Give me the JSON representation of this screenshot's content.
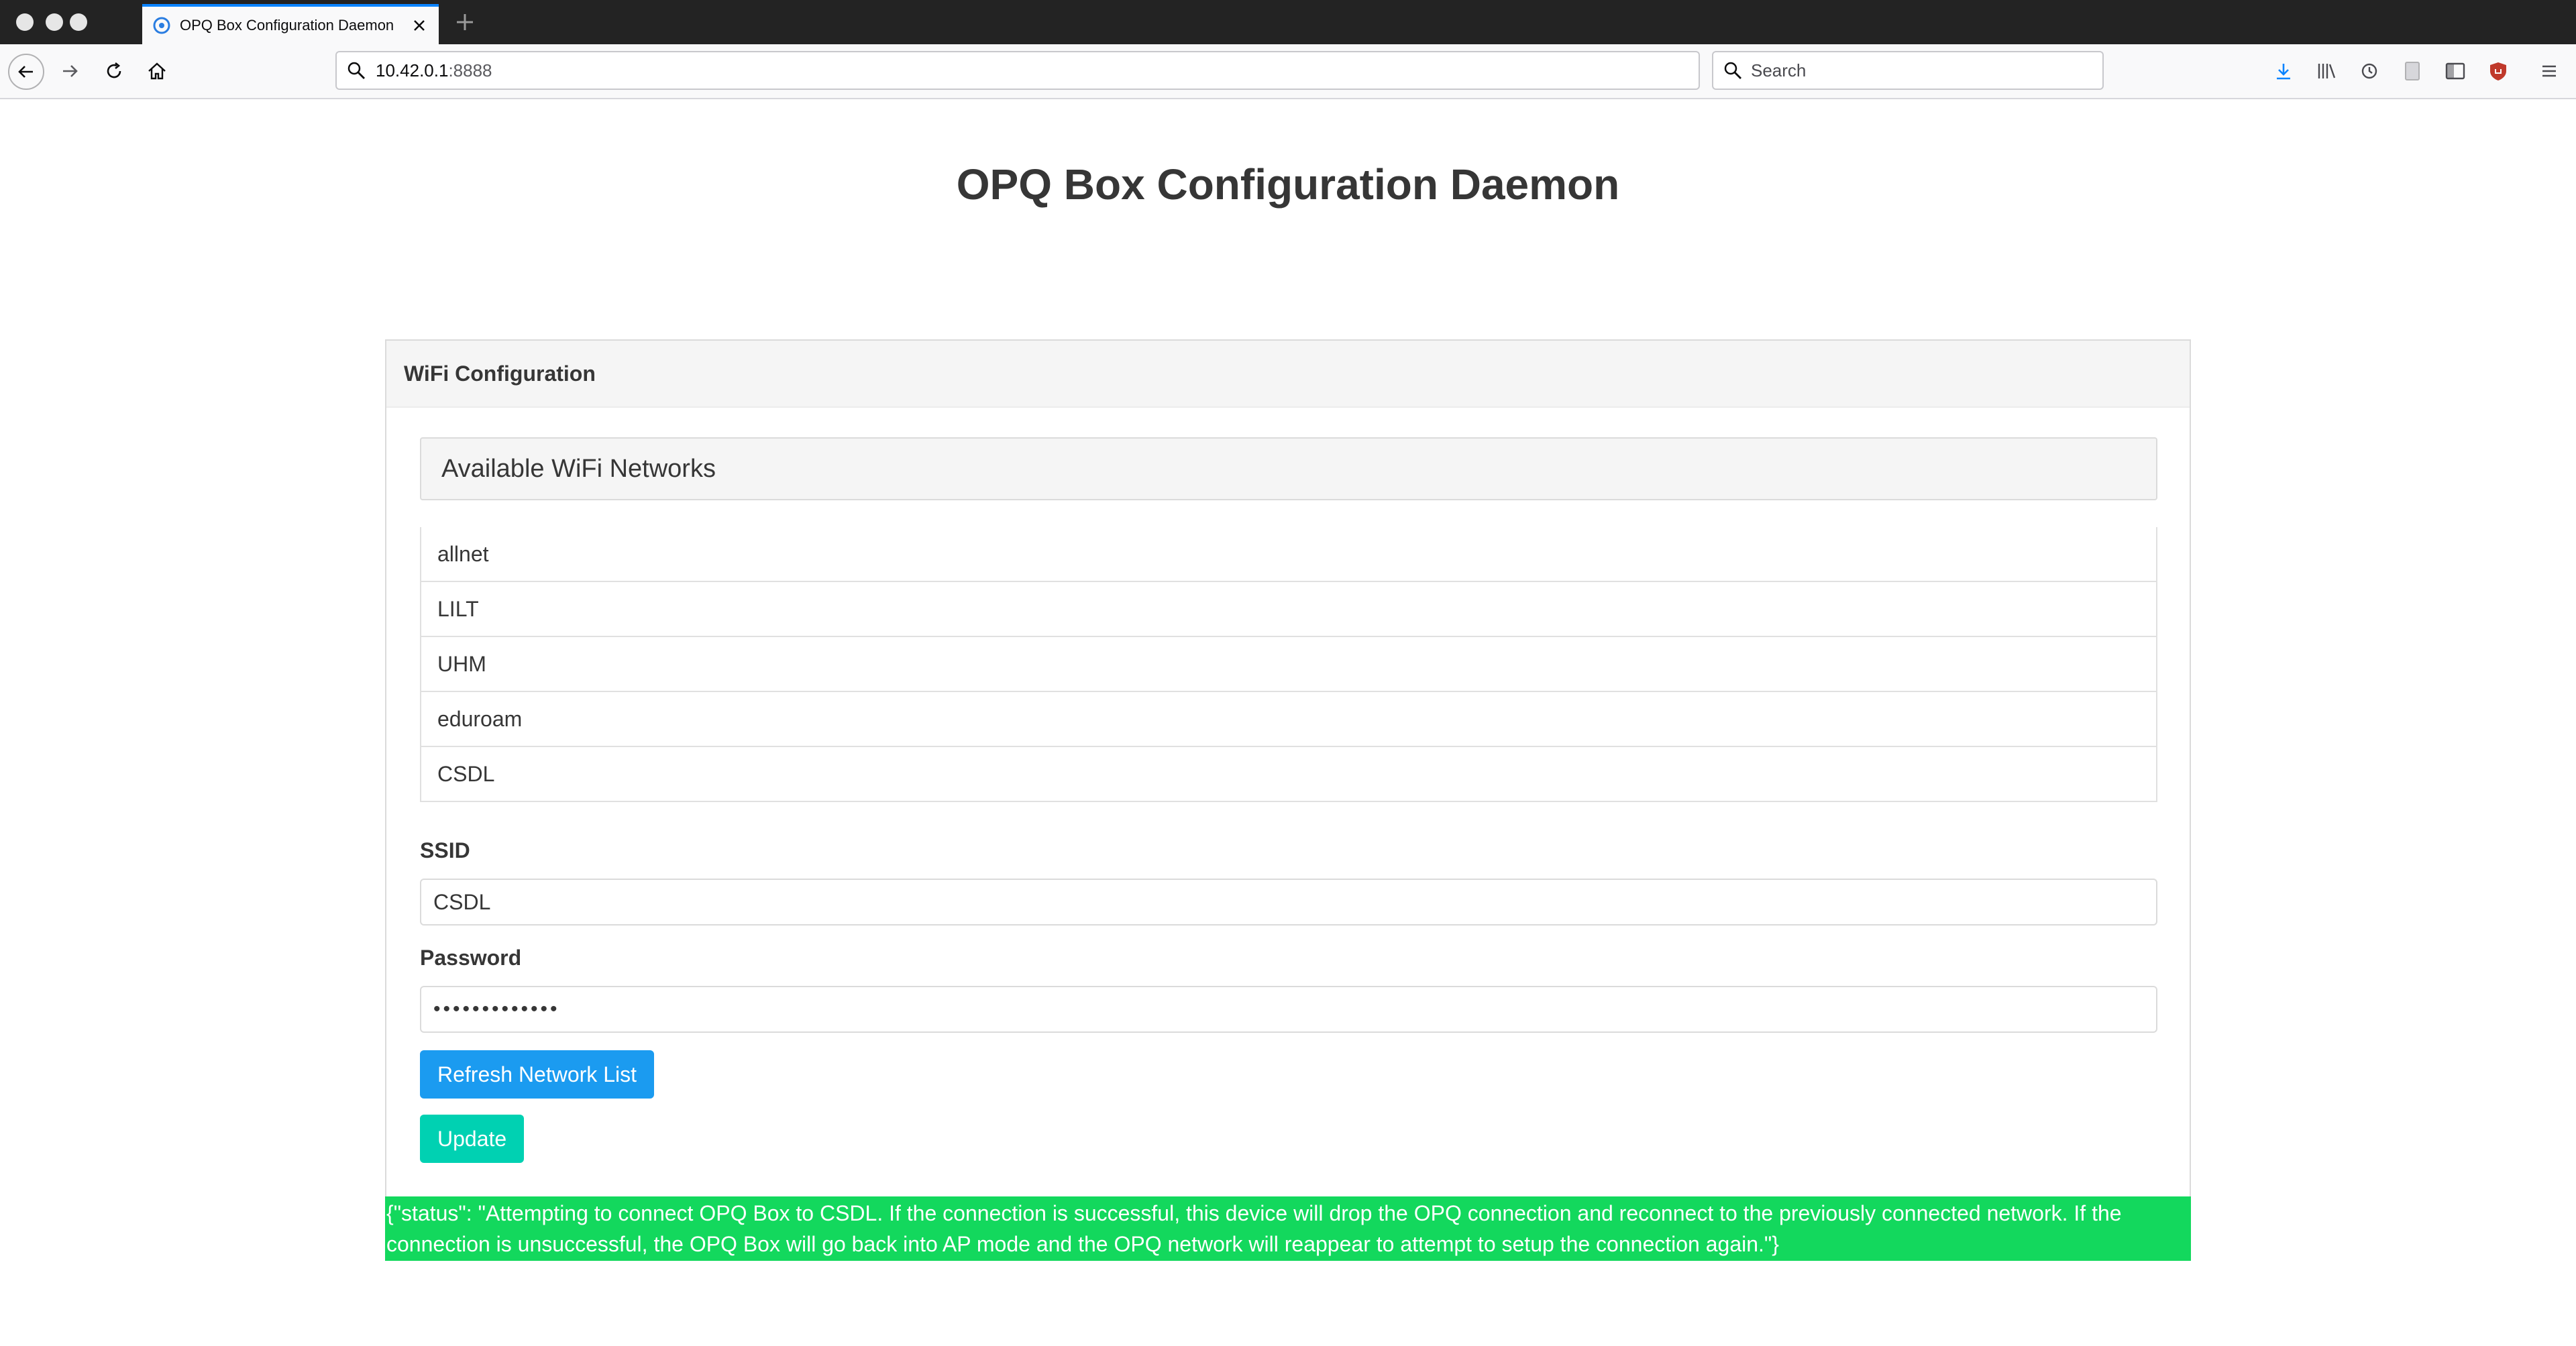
{
  "browser": {
    "tab": {
      "title": "OPQ Box Configuration Daemon"
    },
    "address": {
      "host": "10.42.0.1",
      "port": ":8888"
    },
    "search": {
      "placeholder": "Search"
    },
    "icons": {
      "traffic_lights": [
        "window-close-dot",
        "window-minimize-dot",
        "window-zoom-dot"
      ],
      "nav": [
        "back-icon",
        "forward-icon",
        "reload-icon",
        "home-icon"
      ],
      "right_toolbar": [
        "download-icon",
        "library-icon",
        "history-icon",
        "reader-icon",
        "sidebar-icon",
        "shield-extension-icon",
        "menu-icon"
      ]
    },
    "accent_color": "#0a84ff"
  },
  "page": {
    "title": "OPQ Box Configuration Daemon",
    "card": {
      "header": "WiFi Configuration",
      "networks_heading": "Available WiFi Networks",
      "networks": [
        "allnet",
        "LILT",
        "UHM",
        "eduroam",
        "CSDL"
      ],
      "ssid_label": "SSID",
      "ssid_value": "CSDL",
      "password_label": "Password",
      "password_value": "•••••••••••••",
      "refresh_button": "Refresh Network List",
      "update_button": "Update"
    },
    "status_message": "{\"status\": \"Attempting to connect OPQ Box to CSDL. If the connection is successful, this device will drop the OPQ connection and reconnect to the previously connected network. If the connection is unsuccessful, the OPQ Box will go back into AP mode and the OPQ network will reappear to attempt to setup the connection again.\"}",
    "colors": {
      "refresh_button": "#1b9bf0",
      "update_button": "#00d1b2",
      "status_background": "#13d85d"
    }
  }
}
